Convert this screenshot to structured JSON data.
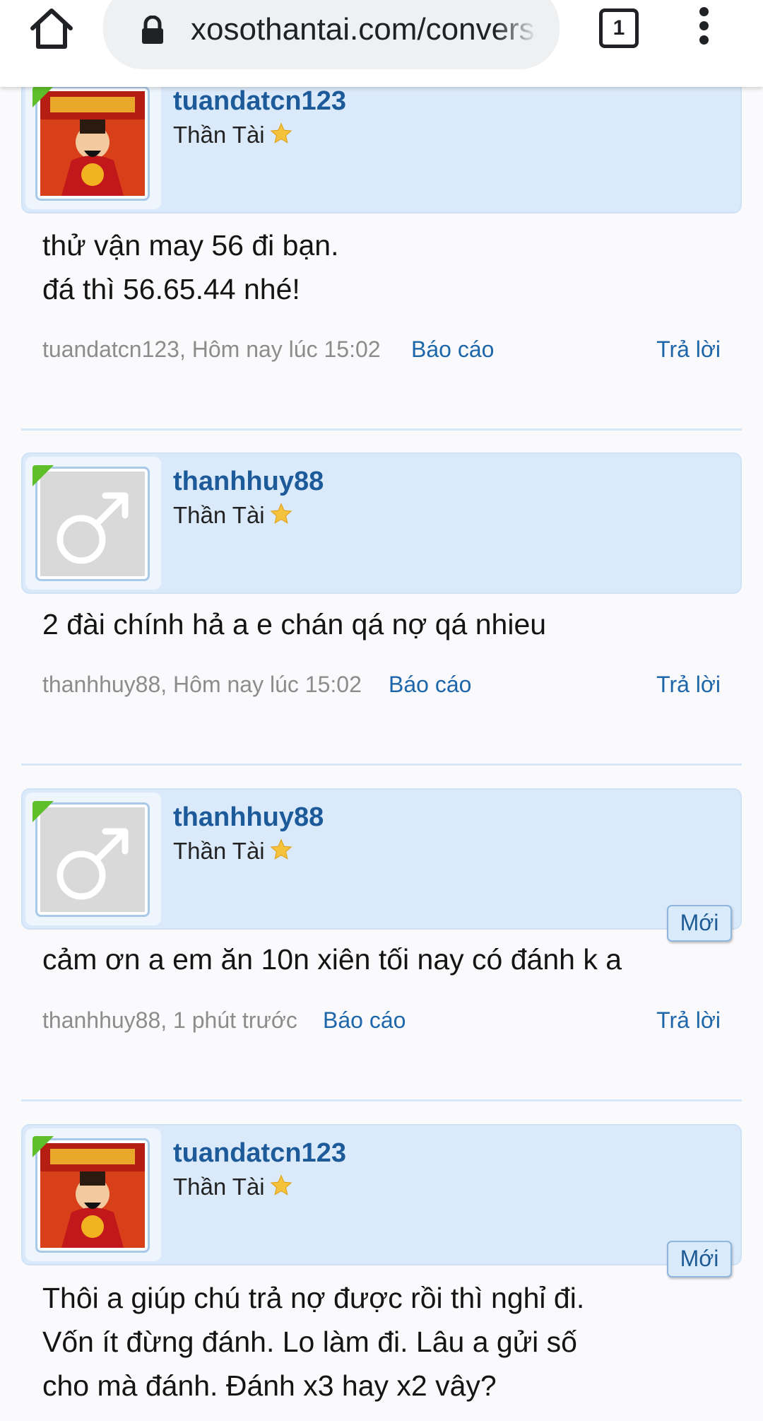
{
  "browser": {
    "url": "xosothantai.com/conversations/",
    "tab_count": "1"
  },
  "posts": [
    {
      "username": "tuandatcn123",
      "rank": "Thần Tài",
      "avatar": "than-tai-avatar",
      "message": "thử vận may 56 đi bạn.\nđá thì 56.65.44 nhé!",
      "meta": "tuandatcn123, Hôm nay lúc 15:02",
      "report_label": "Báo cáo",
      "reply_label": "Trả lời"
    },
    {
      "username": "thanhhuy88",
      "rank": "Thần Tài",
      "avatar": "default-male-avatar",
      "message": "2 đài chính hả a e chán qá nợ qá nhieu",
      "meta": "thanhhuy88, Hôm nay lúc 15:02",
      "report_label": "Báo cáo",
      "reply_label": "Trả lời"
    },
    {
      "username": "thanhhuy88",
      "rank": "Thần Tài",
      "avatar": "default-male-avatar",
      "new_badge": "Mới",
      "message": "cảm ơn a em ăn 10n xiên tối nay có đánh k a",
      "meta": "thanhhuy88, 1 phút trước",
      "report_label": "Báo cáo",
      "reply_label": "Trả lời"
    },
    {
      "username": "tuandatcn123",
      "rank": "Thần Tài",
      "avatar": "than-tai-avatar",
      "new_badge": "Mới",
      "message": "Thôi a giúp chú trả nợ được rồi thì nghỉ đi.\nVốn ít đừng đánh. Lo làm đi. Lâu a gửi số\ncho mà đánh. Đánh x3 hay x2 vây?"
    }
  ]
}
